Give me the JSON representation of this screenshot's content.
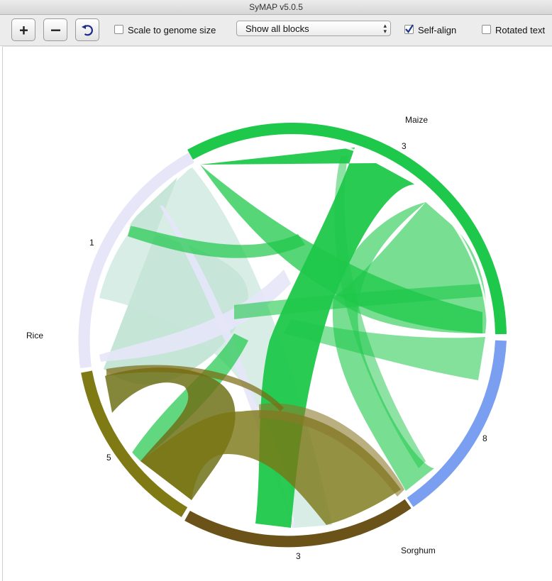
{
  "window": {
    "title": "SyMAP v5.0.5"
  },
  "toolbar": {
    "zoom_in_icon": "plus-icon",
    "zoom_out_icon": "minus-icon",
    "reset_icon": "refresh-icon",
    "scale_to_genome_label": "Scale to genome size",
    "scale_to_genome_checked": false,
    "blocks_select_value": "Show all blocks",
    "self_align_label": "Self-align",
    "self_align_checked": true,
    "rotated_text_label": "Rotated text",
    "rotated_text_checked": false
  },
  "circle": {
    "genomes": [
      {
        "name": "Maize",
        "color": "#1ec84a"
      },
      {
        "name": "Rice",
        "color": "#e6e6f8"
      },
      {
        "name": "Sorghum",
        "color": "#6b5219"
      }
    ],
    "chromosomes": [
      {
        "label": "3",
        "genome": "Maize",
        "color": "#1ec84a"
      },
      {
        "label": "8",
        "genome": "Maize",
        "color": "#7b9ff0"
      },
      {
        "label": "3",
        "genome": "Sorghum",
        "color": "#6b5219"
      },
      {
        "label": "5",
        "genome": "Sorghum",
        "color": "#7f7a14"
      },
      {
        "label": "1",
        "genome": "Rice",
        "color": "#e6e6f8"
      }
    ]
  }
}
